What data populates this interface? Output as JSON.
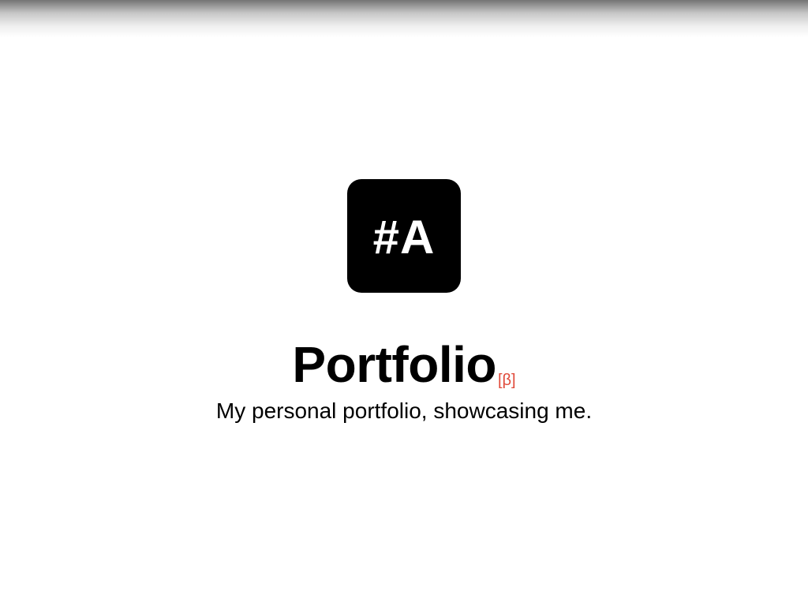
{
  "header": {
    "logo_text": "#A"
  },
  "hero": {
    "title": "Portfolio",
    "badge": "[β]",
    "badge_color": "#e04a3a",
    "subtitle": "My personal portfolio, showcasing me."
  }
}
